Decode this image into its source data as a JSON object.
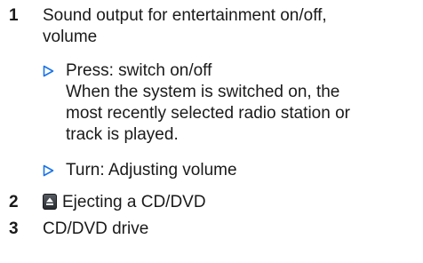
{
  "items": [
    {
      "number": "1",
      "line1": "Sound output for entertainment on/off,",
      "line2": "volume",
      "subitems": [
        {
          "lines": [
            "Press: switch on/off",
            "When the system is switched on, the",
            "most recently selected radio station or",
            "track is played."
          ]
        },
        {
          "lines": [
            "Turn: Adjusting volume"
          ]
        }
      ]
    },
    {
      "number": "2",
      "icon": "eject-icon",
      "text": "Ejecting a CD/DVD"
    },
    {
      "number": "3",
      "text": "CD/DVD drive"
    }
  ],
  "colors": {
    "bullet": "#1a73e8",
    "text": "#1a1a1a"
  }
}
